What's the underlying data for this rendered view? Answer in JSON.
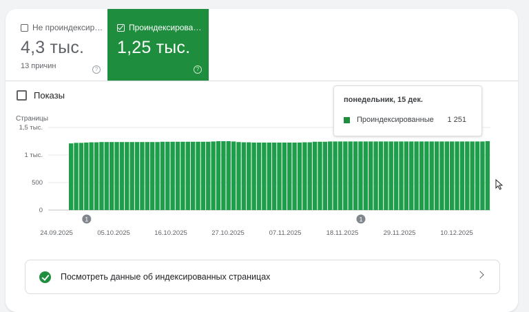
{
  "tiles": {
    "not_indexed": {
      "label": "Не проиндексир…",
      "value": "4,3 тыс.",
      "sub": "13 причин"
    },
    "indexed": {
      "label": "Проиндексирова…",
      "value": "1,25 тыс."
    },
    "help_glyph": "?"
  },
  "impressions_label": "Показы",
  "tooltip": {
    "date": "понедельник, 15 дек.",
    "series": "Проиндексированные",
    "value": "1 251"
  },
  "link_row": {
    "label": "Посмотреть данные об индексированных страницах"
  },
  "icons": [
    "checkbox-icon",
    "help-icon",
    "check-circle-icon",
    "chevron-right-icon",
    "cursor-icon"
  ],
  "colors": {
    "accent": "#1e8e3e",
    "bar": "#1e9e4a"
  },
  "chart_data": {
    "type": "bar",
    "ylabel": "Страницы",
    "ylim": [
      0,
      1500
    ],
    "y_ticks": [
      0,
      500,
      1000,
      1500
    ],
    "y_tick_labels": [
      "0",
      "500",
      "1 тыс.",
      "1,5 тыс."
    ],
    "x_tick_labels": [
      "24.09.2025",
      "05.10.2025",
      "16.10.2025",
      "27.10.2025",
      "07.11.2025",
      "18.11.2025",
      "29.11.2025",
      "10.12.2025"
    ],
    "annotations": [
      {
        "label": "1",
        "after_bar": 3
      },
      {
        "label": "1",
        "after_bar": 57
      }
    ],
    "series": [
      {
        "values": [
          1210,
          1220,
          1220,
          1225,
          1230,
          1230,
          1235,
          1235,
          1235,
          1235,
          1235,
          1235,
          1235,
          1235,
          1235,
          1235,
          1235,
          1235,
          1240,
          1240,
          1240,
          1240,
          1240,
          1240,
          1240,
          1240,
          1240,
          1240,
          1245,
          1250,
          1250,
          1250,
          1245,
          1235,
          1230,
          1230,
          1225,
          1225,
          1225,
          1225,
          1225,
          1225,
          1225,
          1225,
          1225,
          1225,
          1230,
          1230,
          1240,
          1240,
          1240,
          1245,
          1245,
          1245,
          1245,
          1245,
          1245,
          1245,
          1245,
          1245,
          1245,
          1245,
          1245,
          1245,
          1245,
          1245,
          1245,
          1245,
          1245,
          1245,
          1245,
          1245,
          1245,
          1245,
          1245,
          1245,
          1245,
          1245,
          1245,
          1245,
          1245,
          1245,
          1251
        ]
      }
    ]
  }
}
